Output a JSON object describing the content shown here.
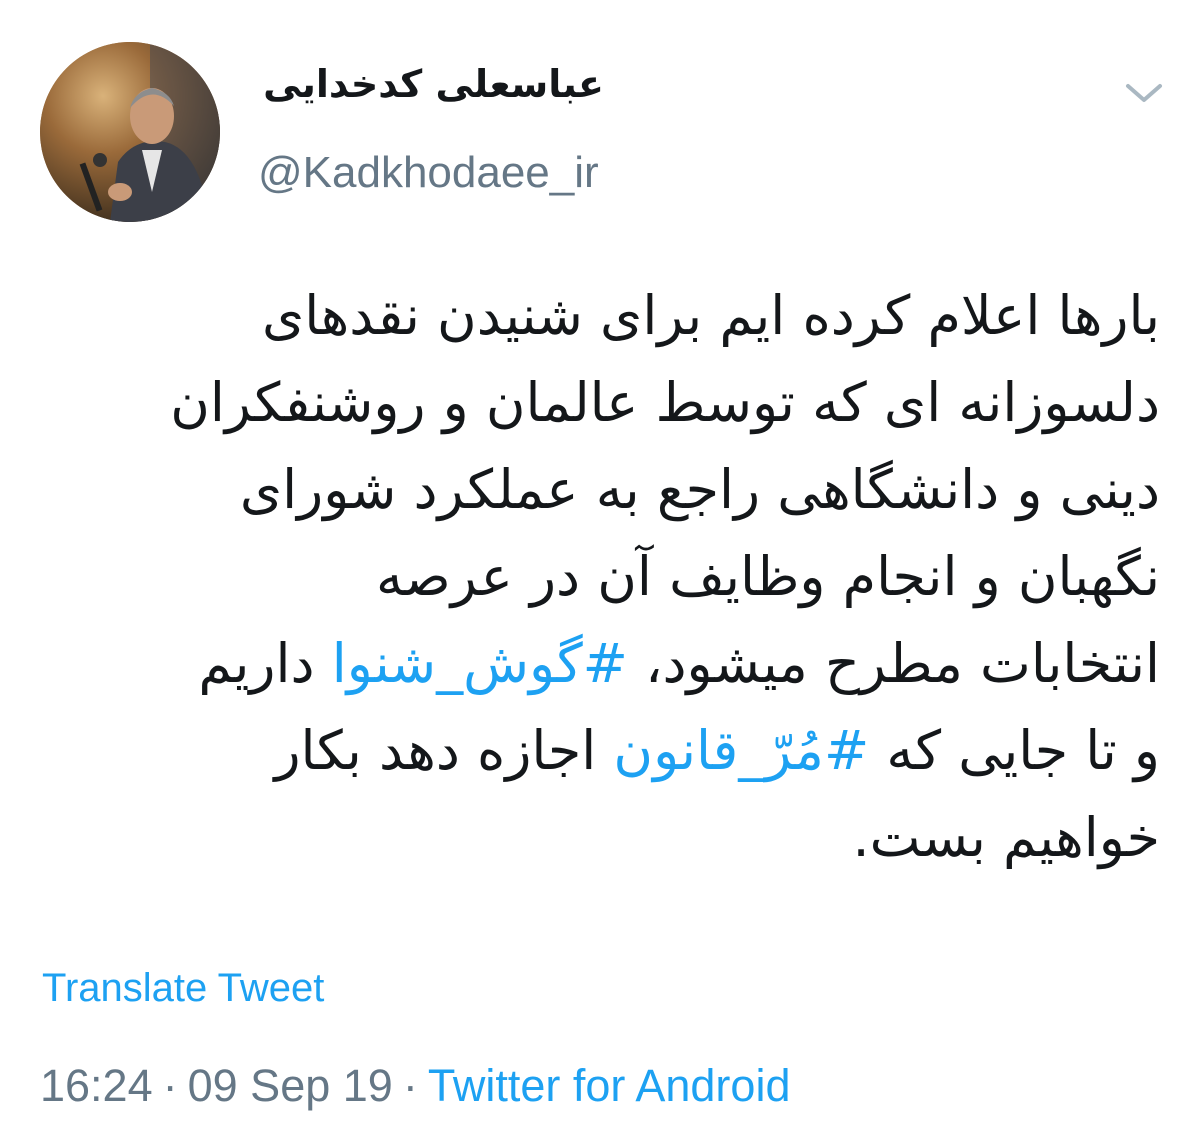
{
  "tweet": {
    "display_name": "عباسعلی کدخدایی",
    "handle": "@Kadkhodaee_ir",
    "avatar_icon": "user-avatar-photo",
    "menu_icon": "chevron-down-icon",
    "lines": [
      {
        "parts": [
          {
            "text": "بارها اعلام کرده ایم برای شنیدن نقدهای",
            "type": "text"
          }
        ]
      },
      {
        "parts": [
          {
            "text": "دلسوزانه ای که توسط عالمان و روشنفکران",
            "type": "text"
          }
        ]
      },
      {
        "parts": [
          {
            "text": "دینی و دانشگاهی راجع به عملکرد شورای",
            "type": "text"
          }
        ]
      },
      {
        "parts": [
          {
            "text": "نگهبان و انجام وظایف آن در عرصه",
            "type": "text"
          }
        ]
      },
      {
        "parts": [
          {
            "text": "انتخابات مطرح میشود، ",
            "type": "text"
          },
          {
            "text": "#گوش_شنوا",
            "type": "hashtag"
          },
          {
            "text": " داریم",
            "type": "text"
          }
        ]
      },
      {
        "parts": [
          {
            "text": "و تا جایی که ",
            "type": "text"
          },
          {
            "text": "#مُرّ_قانون",
            "type": "hashtag"
          },
          {
            "text": " اجازه دهد بکار",
            "type": "text"
          }
        ]
      },
      {
        "parts": [
          {
            "text": "خواهیم بست.",
            "type": "text"
          }
        ]
      }
    ],
    "translate_label": "Translate Tweet",
    "time": "16:24",
    "date": "09 Sep 19",
    "separator": "·",
    "source": "Twitter for Android"
  },
  "colors": {
    "accent": "#1da1f2",
    "text": "#14171a",
    "secondary": "#657786"
  }
}
